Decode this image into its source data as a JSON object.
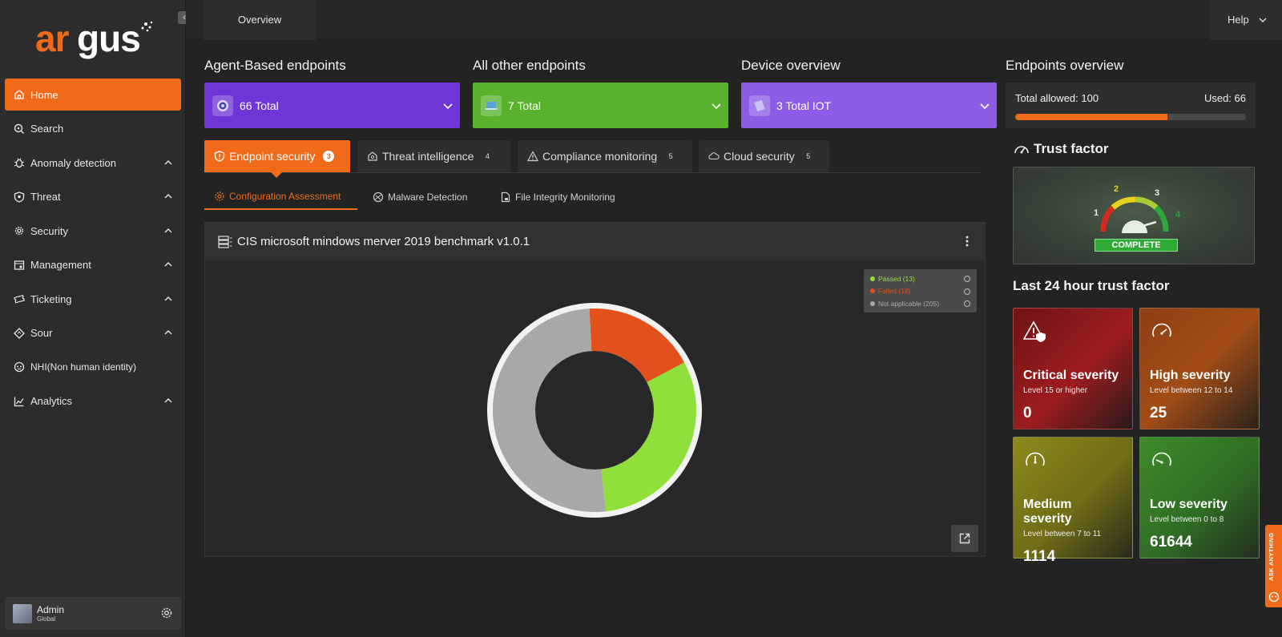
{
  "brand": {
    "logo_text": "argus",
    "accent": "#f06a19"
  },
  "sidebar": {
    "items": [
      {
        "label": "Home",
        "icon": "home-icon",
        "active": true
      },
      {
        "label": "Search",
        "icon": "search-icon"
      },
      {
        "label": "Anomaly detection",
        "icon": "bug-icon",
        "expandable": true
      },
      {
        "label": "Threat",
        "icon": "shield-icon",
        "expandable": true
      },
      {
        "label": "Security",
        "icon": "security-gear-icon",
        "expandable": true
      },
      {
        "label": "Management",
        "icon": "management-icon",
        "expandable": true
      },
      {
        "label": "Ticketing",
        "icon": "ticket-icon",
        "expandable": true
      },
      {
        "label": "Sour",
        "icon": "diamond-icon",
        "expandable": true
      },
      {
        "label": "NHI(Non human identity)",
        "icon": "robot-icon"
      },
      {
        "label": "Analytics",
        "icon": "analytics-icon",
        "expandable": true
      }
    ],
    "user": {
      "name": "Admin",
      "role": "Global"
    }
  },
  "topbar": {
    "tab": "Overview",
    "help": "Help"
  },
  "sections": {
    "agent": {
      "title": "Agent-Based endpoints",
      "value": "66 Total",
      "color": "#6f35d6"
    },
    "other": {
      "title": "All other endpoints",
      "value": "7 Total",
      "color": "#58b22b"
    },
    "device": {
      "title": "Device overview",
      "value": "3 Total IOT",
      "color": "#8c5ce6"
    }
  },
  "tabs": [
    {
      "label": "Endpoint security",
      "badge": "3",
      "icon": "shield-alert-icon",
      "active": true
    },
    {
      "label": "Threat intelligence",
      "badge": "4",
      "icon": "home-shield-icon"
    },
    {
      "label": "Compliance monitoring",
      "badge": "5",
      "icon": "warning-icon"
    },
    {
      "label": "Cloud security",
      "badge": "5",
      "icon": "cloud-icon"
    }
  ],
  "subtabs": [
    {
      "label": "Configuration Assessment",
      "icon": "gear-icon",
      "active": true
    },
    {
      "label": "Malware Detection",
      "icon": "malware-icon"
    },
    {
      "label": "File Integrity Monitoring",
      "icon": "file-lock-icon"
    }
  ],
  "panel": {
    "title": "CIS microsoft mindows merver 2019 benchmark v1.0.1"
  },
  "chart_data": {
    "type": "pie",
    "categories": [
      "Passed (13)",
      "Failed (18)",
      "Not applicable (205)"
    ],
    "values": [
      13,
      18,
      205
    ],
    "colors": [
      "#8fe03a",
      "#e2501b",
      "#a8a8a8"
    ],
    "legend": "top-right"
  },
  "endpoints_overview": {
    "title": "Endpoints overview",
    "allowed_label": "Total allowed: 100",
    "used_label": "Used: 66",
    "used_fraction": 0.66
  },
  "trust": {
    "title": "Trust factor",
    "status": "COMPLETE",
    "ticks": [
      "1",
      "2",
      "3",
      "4"
    ]
  },
  "last24": {
    "title": "Last 24 hour trust factor",
    "cards": [
      {
        "title": "Critical severity",
        "sub": "Level 15 or higher",
        "value": "0"
      },
      {
        "title": "High severity",
        "sub": "Level between 12 to 14",
        "value": "25"
      },
      {
        "title": "Medium severity",
        "sub": "Level between 7 to 11",
        "value": "1114"
      },
      {
        "title": "Low severity",
        "sub": "Level between 0 to 8",
        "value": "61644"
      }
    ]
  },
  "ask": {
    "label": "ASK ANYTHING"
  }
}
